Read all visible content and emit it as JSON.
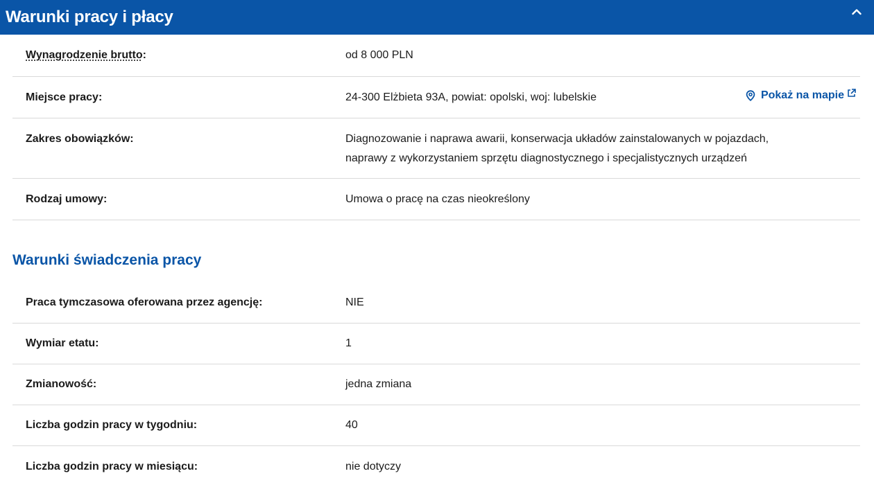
{
  "header": {
    "title": "Warunki pracy i płacy",
    "collapse_icon": "chevron-up-icon"
  },
  "pay": {
    "rows": [
      {
        "label": "Wynagrodzenie brutto",
        "value": "od 8 000 PLN"
      },
      {
        "label": "Miejsce pracy:",
        "value": "24-300 Elżbieta 93A, powiat: opolski, woj: lubelskie",
        "link_label": "Pokaż na mapie"
      },
      {
        "label": "Zakres obowiązków:",
        "value_line1": "Diagnozowanie i naprawa awarii, konserwacja układów zainstalowanych w pojazdach,",
        "value_line2": "naprawy z wykorzystaniem sprzętu diagnostycznego i specjalistycznych urządzeń"
      },
      {
        "label": "Rodzaj umowy:",
        "value": "Umowa o pracę na czas nieokreślony"
      }
    ],
    "colon": ":"
  },
  "conditions": {
    "title": "Warunki świadczenia pracy",
    "rows": [
      {
        "label": "Praca tymczasowa oferowana przez agencję:",
        "value": "NIE"
      },
      {
        "label": "Wymiar etatu:",
        "value": "1"
      },
      {
        "label": "Zmianowość:",
        "value": "jedna zmiana"
      },
      {
        "label": "Liczba godzin pracy w tygodniu:",
        "value": "40"
      },
      {
        "label": "Liczba godzin pracy w miesiącu:",
        "value": "nie dotyczy"
      }
    ]
  },
  "colors": {
    "brand": "#0a55a7",
    "divider": "#d9d9d9"
  }
}
